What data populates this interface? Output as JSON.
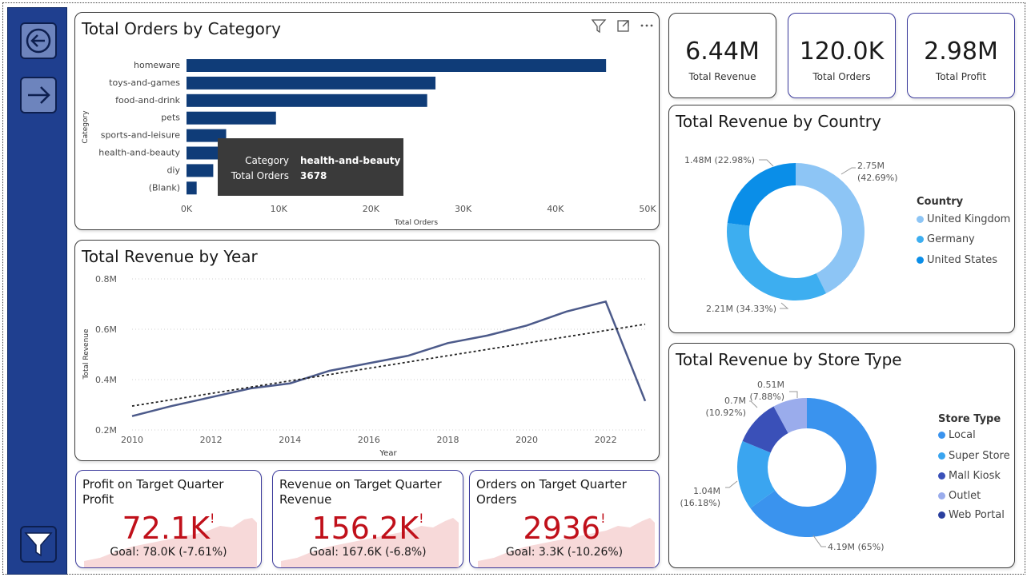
{
  "nav": {
    "back_icon": "back-arrow-icon",
    "forward_icon": "forward-arrow-icon",
    "filter_icon": "filter-icon"
  },
  "kpis": [
    {
      "value": "6.44M",
      "label": "Total Revenue"
    },
    {
      "value": "120.0K",
      "label": "Total Orders"
    },
    {
      "value": "2.98M",
      "label": "Total Profit"
    }
  ],
  "orders_by_category": {
    "title": "Total Orders by Category",
    "ylabel": "Category",
    "xlabel": "Total Orders",
    "ticks": [
      "0K",
      "10K",
      "20K",
      "30K",
      "40K",
      "50K"
    ],
    "tooltip": {
      "k1": "Category",
      "v1": "health-and-beauty",
      "k2": "Total Orders",
      "v2": "3678"
    }
  },
  "revenue_by_year": {
    "title": "Total Revenue by Year",
    "ylabel": "Total Revenue",
    "xlabel": "Year",
    "yticks": [
      "0.8M",
      "0.6M",
      "0.4M",
      "0.2M"
    ],
    "xticks": [
      "2010",
      "2012",
      "2014",
      "2016",
      "2018",
      "2020",
      "2022"
    ]
  },
  "revenue_by_country": {
    "title": "Total Revenue by Country",
    "legend_title": "Country",
    "legend": [
      "United Kingdom",
      "Germany",
      "United States"
    ],
    "labels": [
      "2.75M",
      "(42.69%)",
      "2.21M (34.33%)",
      "1.48M (22.98%)"
    ]
  },
  "revenue_by_store": {
    "title": "Total Revenue by Store Type",
    "legend_title": "Store Type",
    "legend": [
      "Local",
      "Super Store",
      "Mall Kiosk",
      "Outlet",
      "Web Portal"
    ],
    "labels": [
      "4.19M (65%)",
      "1.04M",
      "(16.18%)",
      "0.7M",
      "(10.92%)",
      "0.51M",
      "(7.88%)"
    ]
  },
  "gauges": [
    {
      "title1": "Profit on Target Quarter",
      "title2": "Profit",
      "value": "72.1K",
      "flag": "!",
      "goal": "Goal: 78.0K (-7.61%)"
    },
    {
      "title1": "Revenue on Target Quarter",
      "title2": "Revenue",
      "value": "156.2K",
      "flag": "!",
      "goal": "Goal: 167.6K (-6.8%)"
    },
    {
      "title1": "Orders on Target Quarter",
      "title2": "Orders",
      "value": "2936",
      "flag": "!",
      "goal": "Goal: 3.3K (-10.26%)"
    }
  ],
  "colors": {
    "bar": "#0f3c78",
    "line": "#4c5a8a",
    "uk": "#8dc5f5",
    "de": "#3daef0",
    "us": "#0a8ee8",
    "local": "#3a93ee",
    "super": "#3aa5f0",
    "mall": "#3a50b8",
    "outlet": "#9aacec",
    "web": "#2a3f9e",
    "alert": "#c0101a"
  },
  "chart_data": [
    {
      "type": "bar",
      "title": "Total Orders by Category",
      "xlabel": "Total Orders",
      "ylabel": "Category",
      "categories": [
        "homeware",
        "toys-and-games",
        "food-and-drink",
        "pets",
        "sports-and-leisure",
        "health-and-beauty",
        "diy",
        "(Blank)"
      ],
      "values": [
        45500,
        27000,
        26100,
        9700,
        4300,
        3678,
        2900,
        1100
      ],
      "xlim": [
        0,
        50000
      ]
    },
    {
      "type": "line",
      "title": "Total Revenue by Year",
      "xlabel": "Year",
      "ylabel": "Total Revenue",
      "x": [
        2010,
        2011,
        2012,
        2013,
        2014,
        2015,
        2016,
        2017,
        2018,
        2019,
        2020,
        2021,
        2022,
        2023
      ],
      "series": [
        {
          "values": [
            0.255,
            0.295,
            0.33,
            0.365,
            0.385,
            0.435,
            0.465,
            0.495,
            0.545,
            0.575,
            0.615,
            0.67,
            0.71,
            0.315
          ]
        }
      ],
      "trend": [
        0.295,
        0.62
      ],
      "ylim": [
        0.2,
        0.8
      ]
    },
    {
      "type": "pie",
      "title": "Total Revenue by Country",
      "categories": [
        "United Kingdom",
        "Germany",
        "United States"
      ],
      "values": [
        2.75,
        2.21,
        1.48
      ],
      "percent": [
        42.69,
        34.33,
        22.98
      ]
    },
    {
      "type": "pie",
      "title": "Total Revenue by Store Type",
      "categories": [
        "Local",
        "Super Store",
        "Mall Kiosk",
        "Outlet",
        "Web Portal"
      ],
      "values": [
        4.19,
        1.04,
        0.7,
        0.51,
        0
      ],
      "percent": [
        65,
        16.18,
        10.92,
        7.88,
        0
      ]
    }
  ]
}
